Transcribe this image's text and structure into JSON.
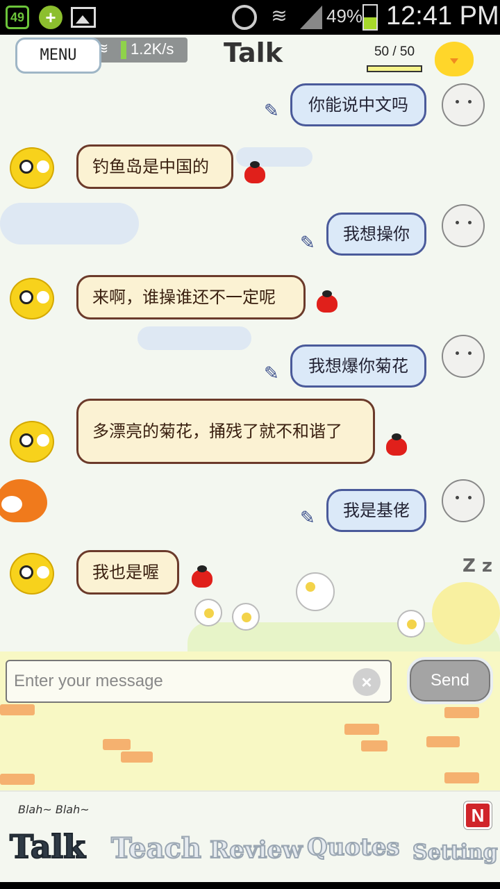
{
  "status_bar": {
    "notification_count": "49",
    "battery_percent": "49%",
    "time": "12:41 PM",
    "icons": [
      "notification-count-icon",
      "plus-game-icon",
      "picture-icon",
      "alarm-icon",
      "wifi-icon",
      "signal-icon",
      "battery-icon"
    ]
  },
  "header": {
    "menu_label": "MENU",
    "network_speed": "1.2K/s",
    "title": "Talk",
    "counter": "50 / 50",
    "counter_level": 1.0
  },
  "messages": [
    {
      "from": "me",
      "text": "你能说中文吗"
    },
    {
      "from": "bot",
      "text": "钓鱼岛是中国的"
    },
    {
      "from": "me",
      "text": "我想操你"
    },
    {
      "from": "bot",
      "text": "来啊，谁操谁还不一定呢"
    },
    {
      "from": "me",
      "text": "我想爆你菊花"
    },
    {
      "from": "bot",
      "text": "多漂亮的菊花，捅残了就不和谐了"
    },
    {
      "from": "me",
      "text": "我是基佬"
    },
    {
      "from": "bot",
      "text": "我也是喔"
    }
  ],
  "composer": {
    "placeholder": "Enter your message",
    "value": "",
    "send_label": "Send"
  },
  "nav": {
    "caption": "Blah~ Blah~",
    "tabs": [
      "Talk",
      "Teach",
      "Review",
      "Quotes",
      "Setting"
    ],
    "active_tab": "Talk",
    "badge": "N"
  },
  "colors": {
    "me_bubble_border": "#4a5a9a",
    "me_bubble_fill": "#dbe9f8",
    "bot_bubble_border": "#6b3a2a",
    "bot_bubble_fill": "#fbf2d3"
  }
}
